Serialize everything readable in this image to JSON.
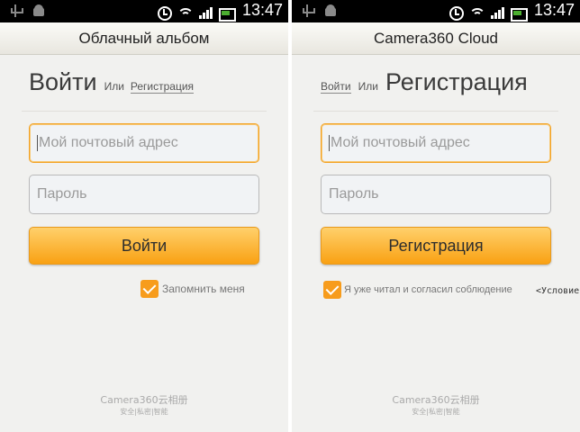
{
  "status_bar": {
    "time": "13:47"
  },
  "left_screen": {
    "title": "Облачный альбом",
    "heading_main": "Войти",
    "heading_or": "Или",
    "heading_link": "Регистрация",
    "email_placeholder": "Мой почтовый адрес",
    "password_placeholder": "Пароль",
    "submit_label": "Войти",
    "remember_label": "Запомнить меня",
    "footer_title": "Camera360云相册",
    "footer_sub": "安全|私密|智能"
  },
  "right_screen": {
    "title": "Camera360 Cloud",
    "heading_link": "Войти",
    "heading_or": "Или",
    "heading_main": "Регистрация",
    "email_placeholder": "Мой почтовый адрес",
    "password_placeholder": "Пароль",
    "submit_label": "Регистрация",
    "agree_label": "Я уже читал и согласил соблюдение",
    "terms_link": "<Условие",
    "footer_title": "Camera360云相册",
    "footer_sub": "安全|私密|智能"
  },
  "colors": {
    "accent": "#f9a113",
    "checkbox": "#f79c1c",
    "focus_border": "#f3a223",
    "background": "#f1f1ef"
  },
  "icons": [
    "usb-icon",
    "android-icon",
    "alarm-icon",
    "wifi-icon",
    "signal-icon",
    "battery-icon"
  ]
}
